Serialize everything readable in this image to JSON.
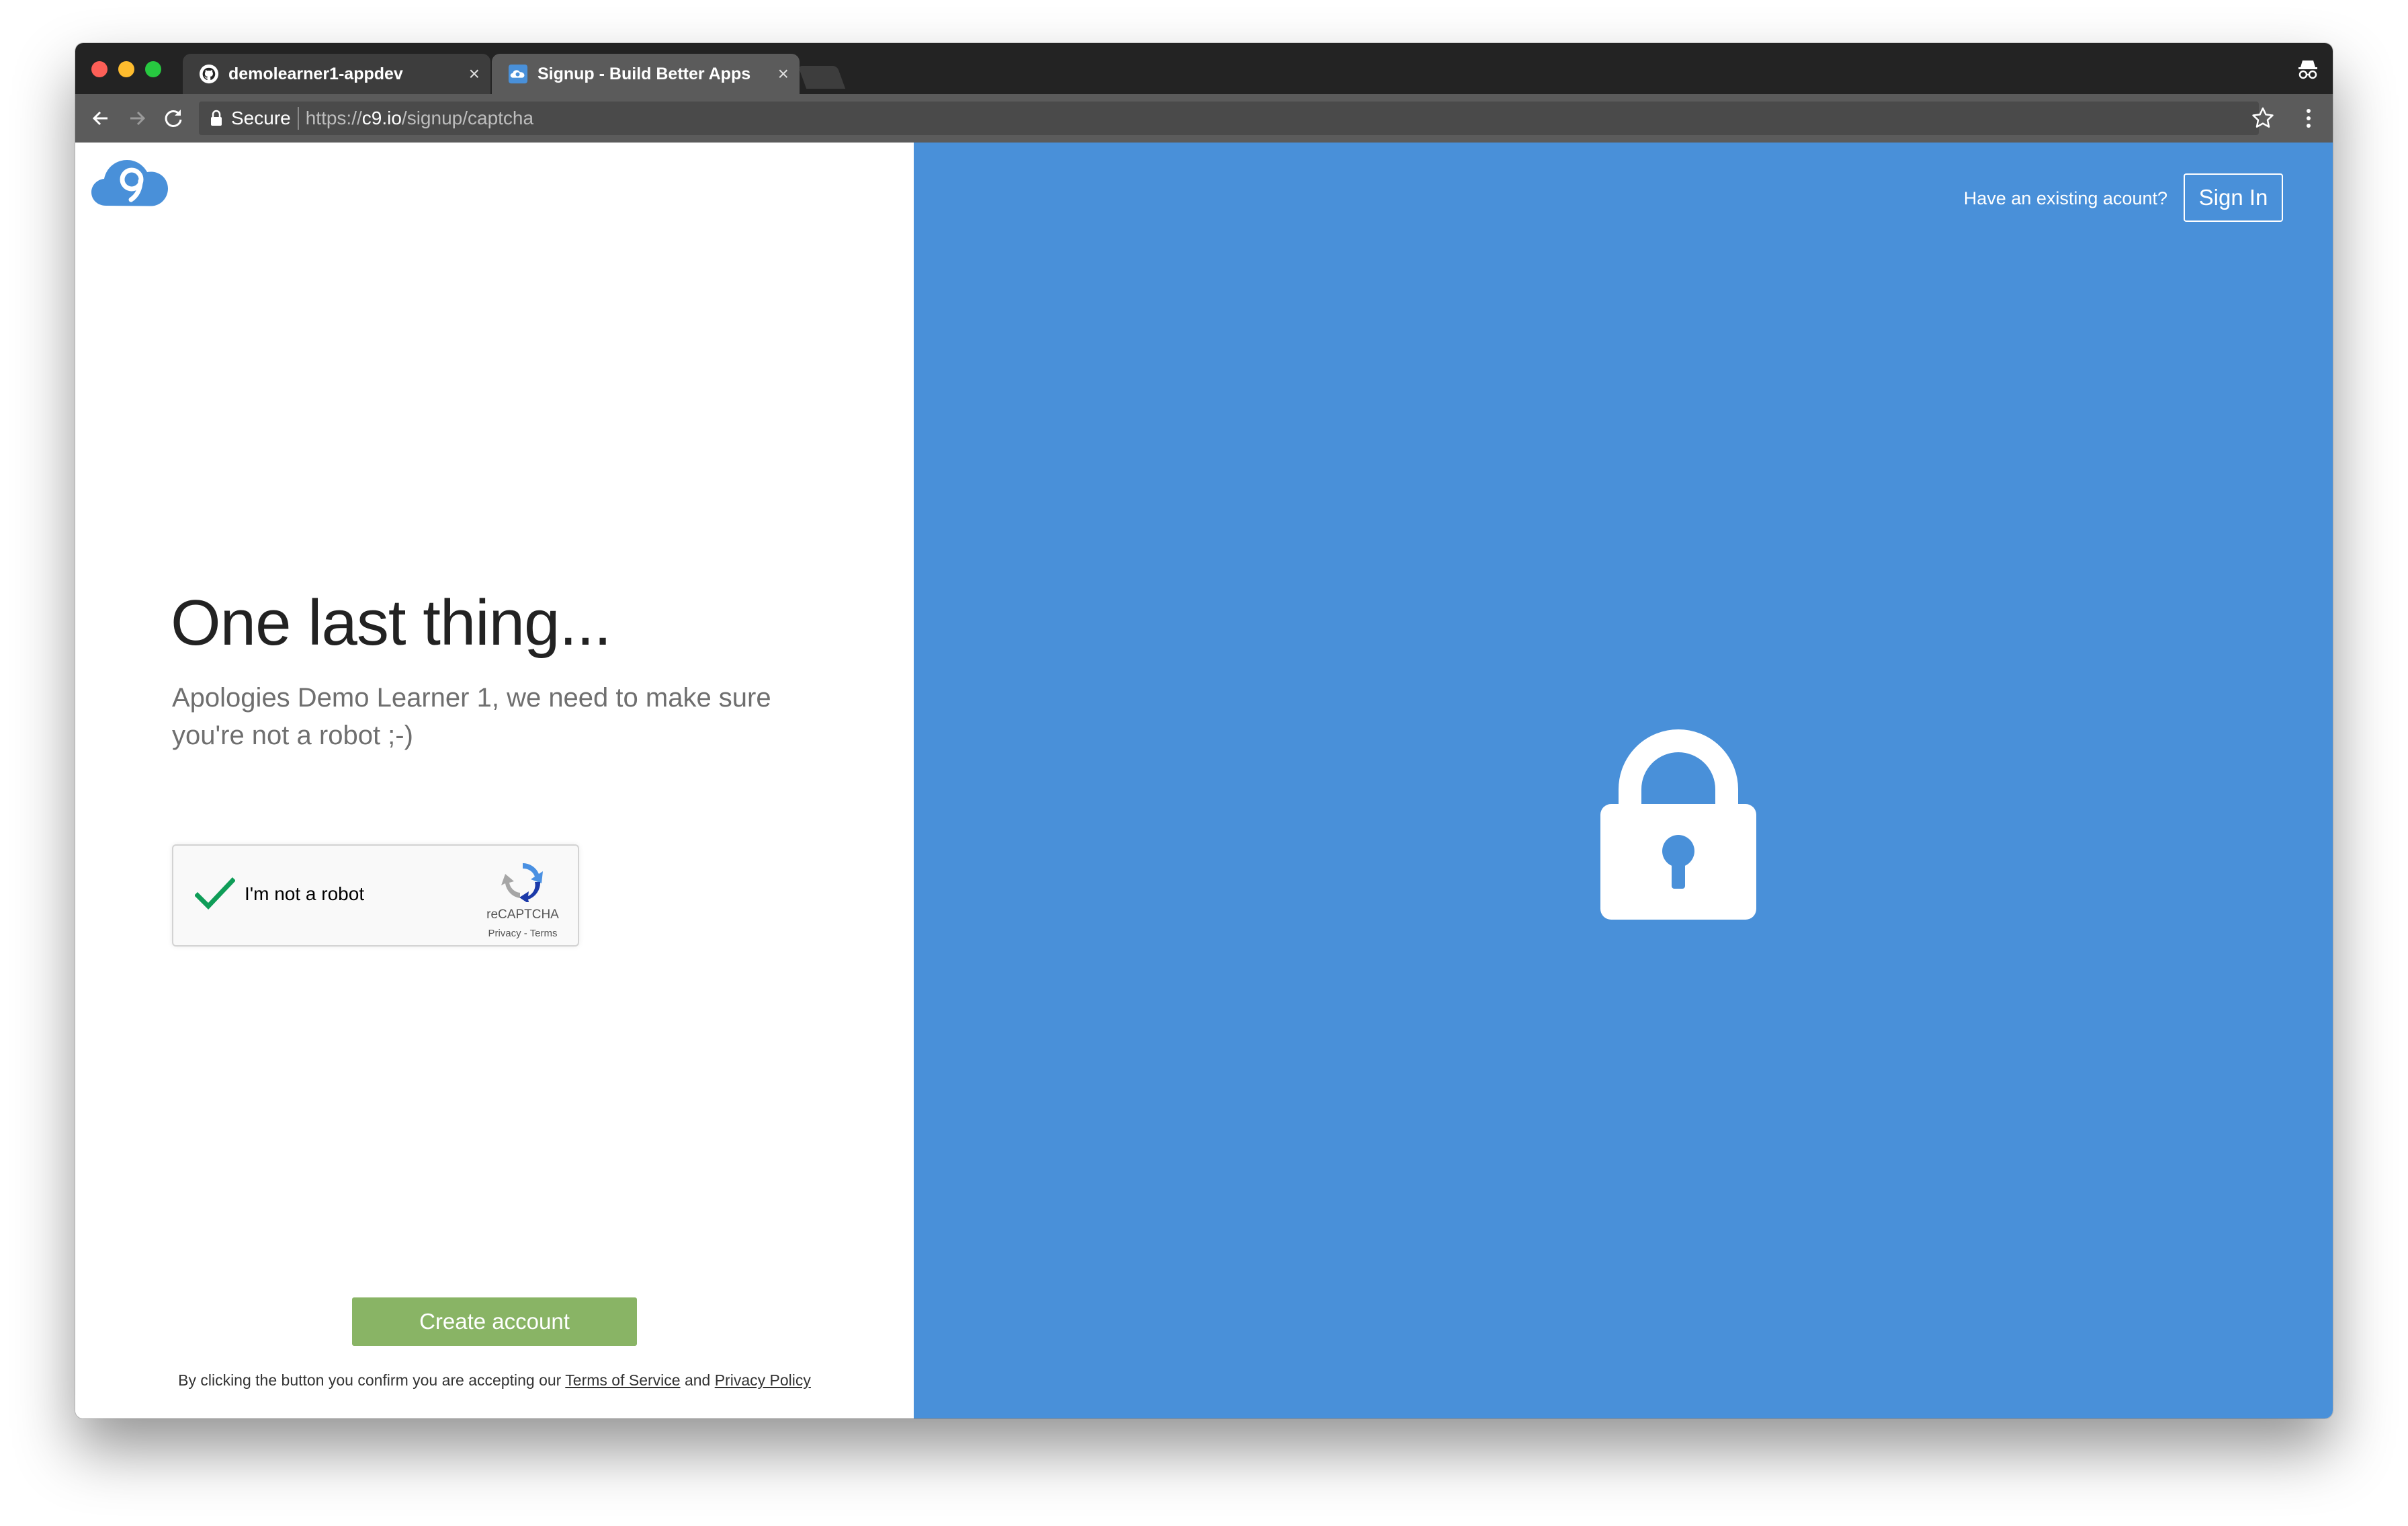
{
  "browser": {
    "tabs": [
      {
        "title": "demolearner1-appdev",
        "favicon": "github-icon"
      },
      {
        "title": "Signup - Build Better Apps",
        "favicon": "cloud9-icon"
      }
    ],
    "close_glyph": "×",
    "security_label": "Secure",
    "url": {
      "scheme": "https://",
      "host": "c9.io",
      "path": "/signup/captcha"
    }
  },
  "header": {
    "existing_account_text": "Have an existing acount?",
    "sign_in_label": "Sign In"
  },
  "main": {
    "headline": "One last thing...",
    "subtext": "Apologies Demo Learner 1, we need to make sure you're not a robot ;-)",
    "captcha": {
      "label": "I'm not a robot",
      "brand": "reCAPTCHA",
      "links": "Privacy - Terms",
      "checked": true
    },
    "create_button_label": "Create account",
    "terms": {
      "prefix": "By clicking the button you confirm you are accepting our ",
      "terms_link": "Terms of Service",
      "conjunction": " and ",
      "privacy_link": "Privacy Policy"
    }
  },
  "colors": {
    "brand_blue": "#4990d9",
    "create_green": "#89b465",
    "check_green": "#0f9d58"
  },
  "icons": {
    "right_panel": "padlock-icon",
    "logo": "cloud9-logo"
  }
}
